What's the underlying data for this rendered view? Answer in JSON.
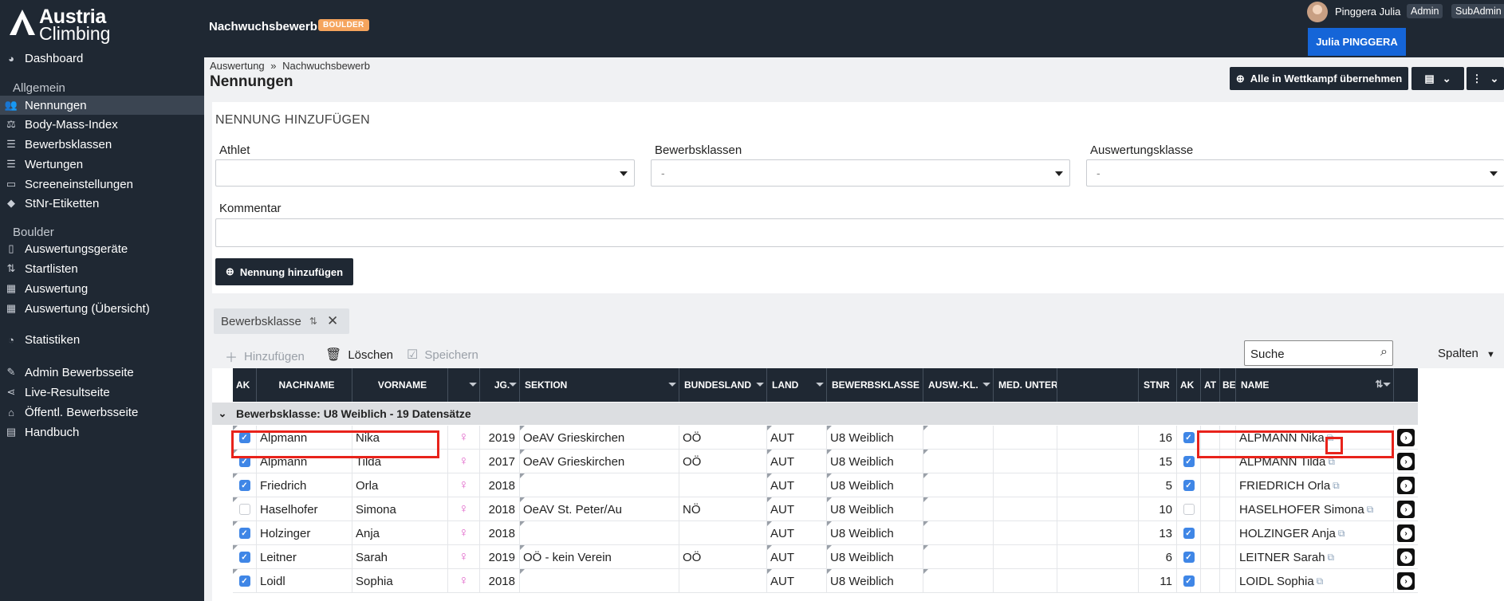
{
  "logo": {
    "line1": "Austria",
    "line2": "Climbing"
  },
  "sidebar": {
    "top_items": [
      {
        "label": "Dashboard",
        "icon": "palette-icon"
      }
    ],
    "sections": [
      {
        "title": "Allgemein",
        "items": [
          {
            "label": "Nennungen",
            "icon": "people-icon",
            "active": true
          },
          {
            "label": "Body-Mass-Index",
            "icon": "scale-icon"
          },
          {
            "label": "Bewerbsklassen",
            "icon": "list-icon"
          },
          {
            "label": "Wertungen",
            "icon": "list-icon"
          },
          {
            "label": "Screeneinstellungen",
            "icon": "monitor-icon"
          },
          {
            "label": "StNr-Etiketten",
            "icon": "tag-icon"
          }
        ]
      },
      {
        "title": "Boulder",
        "items": [
          {
            "label": "Auswertungsgeräte",
            "icon": "tablet-icon"
          },
          {
            "label": "Startlisten",
            "icon": "sort-list-icon"
          },
          {
            "label": "Auswertung",
            "icon": "grid-numbers-icon"
          },
          {
            "label": "Auswertung (Übersicht)",
            "icon": "grid-numbers-icon"
          }
        ]
      }
    ],
    "bottom_items": [
      {
        "label": "Statistiken",
        "icon": "pie-chart-icon"
      },
      {
        "label": "Admin Bewerbsseite",
        "icon": "edit-icon"
      },
      {
        "label": "Live-Resultseite",
        "icon": "share-icon"
      },
      {
        "label": "Öffentl. Bewerbsseite",
        "icon": "home-icon"
      },
      {
        "label": "Handbuch",
        "icon": "book-icon"
      }
    ]
  },
  "topbar": {
    "title": "Nachwuchsbewerb",
    "badge": "BOULDER",
    "user_name": "Pinggera Julia",
    "roles": [
      "Admin",
      "SubAdmin"
    ],
    "user_button": "Julia PINGGERA"
  },
  "pagehead": {
    "breadcrumb": [
      "Auswertung",
      "»",
      "Nachwuchsbewerb"
    ],
    "title": "Nennungen",
    "action_button": "Alle in Wettkampf übernehmen"
  },
  "add_form": {
    "title": "NENNUNG HINZUFÜGEN",
    "athlet_label": "Athlet",
    "athlet_value": "",
    "bewerbsklassen_label": "Bewerbsklassen",
    "bewerbsklassen_value": "-",
    "auswertungsklasse_label": "Auswertungsklasse",
    "auswertungsklasse_value": "-",
    "kommentar_label": "Kommentar",
    "kommentar_value": "",
    "submit_label": "Nennung hinzufügen"
  },
  "group_chip": {
    "label": "Bewerbsklasse"
  },
  "toolbar": {
    "add": "Hinzufügen",
    "delete": "Löschen",
    "save": "Speichern",
    "search_placeholder": "Suche",
    "columns": "Spalten"
  },
  "grid": {
    "columns": [
      "AK",
      "NACHNAME",
      "VORNAME",
      "",
      "JG.",
      "SEKTION",
      "BUNDESLAND",
      "LAND",
      "BEWERBSKLASSE",
      "AUSW.-KL.",
      "MED. UNTER",
      "",
      "STNR",
      "AK",
      "AT",
      "BE",
      "NAME",
      ""
    ],
    "group_label": "Bewerbsklasse: U8 Weiblich - 19 Datensätze",
    "rows": [
      {
        "ak": true,
        "nachname": "Alpmann",
        "vorname": "Nika",
        "jg": "2019",
        "sektion": "OeAV Grieskirchen",
        "bundesland": "OÖ",
        "land": "AUT",
        "klasse": "U8 Weiblich",
        "stnr": "16",
        "ak2": true,
        "name": "ALPMANN Nika"
      },
      {
        "ak": true,
        "nachname": "Alpmann",
        "vorname": "Tilda",
        "jg": "2017",
        "sektion": "OeAV Grieskirchen",
        "bundesland": "OÖ",
        "land": "AUT",
        "klasse": "U8 Weiblich",
        "stnr": "15",
        "ak2": true,
        "name": "ALPMANN Tilda"
      },
      {
        "ak": true,
        "nachname": "Friedrich",
        "vorname": "Orla",
        "jg": "2018",
        "sektion": "",
        "bundesland": "",
        "land": "AUT",
        "klasse": "U8 Weiblich",
        "stnr": "5",
        "ak2": true,
        "name": "FRIEDRICH Orla"
      },
      {
        "ak": false,
        "nachname": "Haselhofer",
        "vorname": "Simona",
        "jg": "2018",
        "sektion": "OeAV St. Peter/Au",
        "bundesland": "NÖ",
        "land": "AUT",
        "klasse": "U8 Weiblich",
        "stnr": "10",
        "ak2": false,
        "name": "HASELHOFER Simona"
      },
      {
        "ak": true,
        "nachname": "Holzinger",
        "vorname": "Anja",
        "jg": "2018",
        "sektion": "",
        "bundesland": "",
        "land": "AUT",
        "klasse": "U8 Weiblich",
        "stnr": "13",
        "ak2": true,
        "name": "HOLZINGER Anja"
      },
      {
        "ak": true,
        "nachname": "Leitner",
        "vorname": "Sarah",
        "jg": "2019",
        "sektion": "OÖ - kein Verein",
        "bundesland": "OÖ",
        "land": "AUT",
        "klasse": "U8 Weiblich",
        "stnr": "6",
        "ak2": true,
        "name": "LEITNER Sarah"
      },
      {
        "ak": true,
        "nachname": "Loidl",
        "vorname": "Sophia",
        "jg": "2018",
        "sektion": "",
        "bundesland": "",
        "land": "AUT",
        "klasse": "U8 Weiblich",
        "stnr": "11",
        "ak2": true,
        "name": "LOIDL Sophia"
      }
    ]
  },
  "colors": {
    "sidebar": "#1f2833",
    "accent": "#1565d8",
    "badge": "#f5a45d",
    "checkbox": "#3f86e6",
    "highlight": "#e8231b"
  }
}
